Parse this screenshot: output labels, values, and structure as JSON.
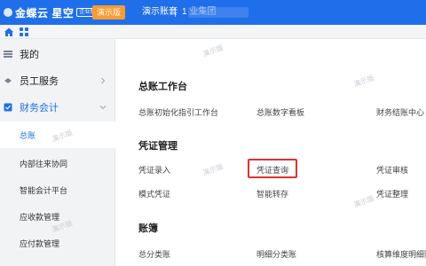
{
  "header": {
    "logo_text": "金蝶云 星空",
    "edition_badge": "企业版",
    "demo_badge": "演示版",
    "account_set": "演示账套",
    "org_name": "1 业集团"
  },
  "colors": {
    "header_bg": "#1f6feb",
    "demo_badge": "#ff9a2e",
    "accent": "#1f6feb",
    "highlight": "#e03131"
  },
  "sidebar": {
    "items": [
      {
        "label": "我的",
        "icon": "star-icon"
      },
      {
        "label": "员工服务",
        "icon": "people-icon"
      },
      {
        "label": "财务会计",
        "icon": "checkbox-icon"
      }
    ],
    "sub_items": [
      "总账",
      "内部往来协同",
      "智能会计平台",
      "应收款管理",
      "应付款管理"
    ]
  },
  "main": {
    "sections": [
      {
        "title": "总账工作台",
        "links": [
          "总账初始化指引工作台",
          "总账数字看板",
          "财务结账中心"
        ]
      },
      {
        "title": "凭证管理",
        "links": [
          "凭证录入",
          "凭证查询",
          "凭证审核",
          "模式凭证",
          "智能转存",
          "凭证整理"
        ]
      },
      {
        "title": "账簿",
        "links": [
          "总分类账",
          "明细分类账",
          "核算维度明细账"
        ]
      }
    ]
  },
  "watermark": "演示版"
}
